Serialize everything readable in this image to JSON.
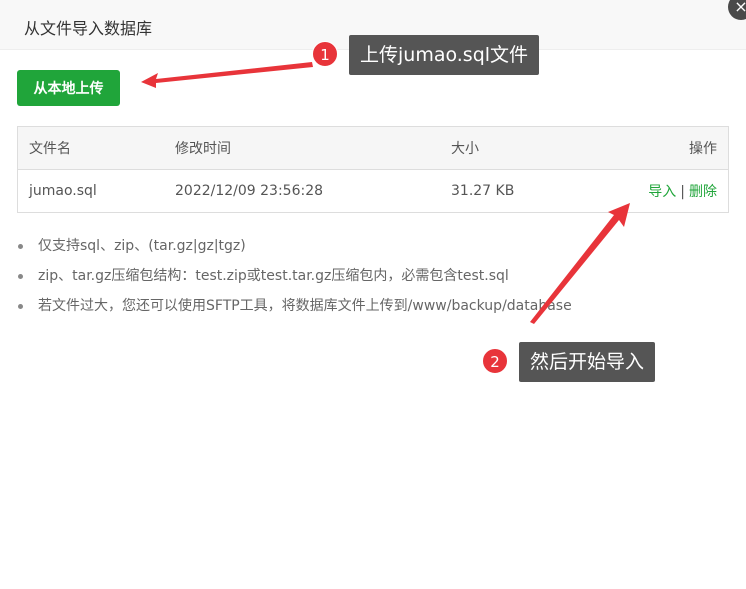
{
  "dialog": {
    "title": "从文件导入数据库",
    "close_icon": "×"
  },
  "toolbar": {
    "upload_label": "从本地上传"
  },
  "table": {
    "headers": [
      "文件名",
      "修改时间",
      "大小",
      "操作"
    ],
    "rows": [
      {
        "name": "jumao.sql",
        "mtime": "2022/12/09 23:56:28",
        "size": "31.27 KB",
        "import_label": "导入",
        "separator": "|",
        "delete_label": "删除"
      }
    ]
  },
  "tips": [
    "仅支持sql、zip、(tar.gz|gz|tgz)",
    "zip、tar.gz压缩包结构：test.zip或test.tar.gz压缩包内，必需包含test.sql",
    "若文件过大，您还可以使用SFTP工具，将数据库文件上传到/www/backup/database"
  ],
  "annotations": [
    {
      "number": "1",
      "text": "上传jumao.sql文件"
    },
    {
      "number": "2",
      "text": "然后开始导入"
    }
  ],
  "colors": {
    "primary_green": "#20a53a",
    "annotation_red": "#e8343a",
    "callout_bg": "#555555"
  }
}
